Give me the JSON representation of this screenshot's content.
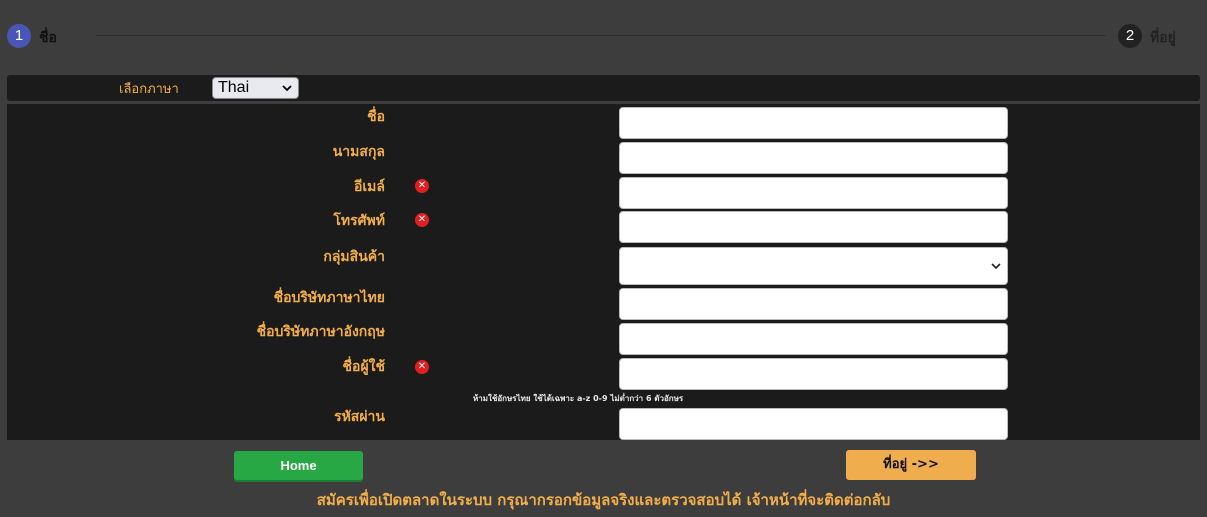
{
  "stepper": {
    "steps": [
      {
        "number": "1",
        "label": "ชื่อ"
      },
      {
        "number": "2",
        "label": "ที่อยู่"
      }
    ]
  },
  "language": {
    "label": "เลือกภาษา",
    "selected": "Thai"
  },
  "form": {
    "fields": [
      {
        "label": "ชื่อ"
      },
      {
        "label": "นามสกุล"
      },
      {
        "label": "อีเมล์"
      },
      {
        "label": "โทรศัพท์"
      },
      {
        "label": "กลุ่มสินค้า"
      },
      {
        "label": "ชื่อบริษัทภาษาไทย"
      },
      {
        "label": "ชื่อบริษัทภาษาอังกฤษ"
      },
      {
        "label": "ชื่อผู้ใช้"
      },
      {
        "label": "รหัสผ่าน"
      }
    ],
    "username_hint": "ห้ามใช้อักษรไทย ใช้ได้เฉพาะ a-z 0-9 ไม่ต่ำกว่า 6 ตัวอักษร"
  },
  "buttons": {
    "home": "Home",
    "next": "ที่อยู่ ->>"
  },
  "footer_note": "สมัครเพื่อเปิดตลาดในระบบ กรุณากรอกข้อมูลจริงและตรวจสอบได้ เจ้าหน้าที่จะติดต่อกลับ",
  "colors": {
    "accent": "#f2ae4a",
    "step_active": "#4a55b8",
    "home_button": "#28a745",
    "next_button": "#f0ad4e",
    "required_icon": "#e02020"
  }
}
